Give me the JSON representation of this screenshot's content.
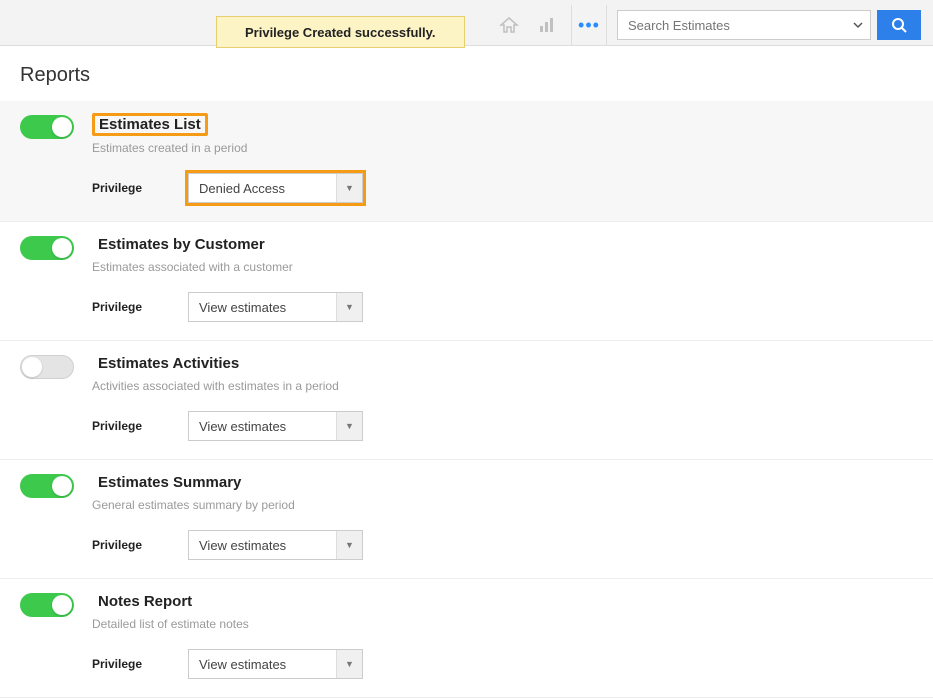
{
  "topbar": {
    "toast": "Privilege Created successfully.",
    "more_icon": "•••",
    "search_placeholder": "Search Estimates"
  },
  "page": {
    "title": "Reports",
    "privilege_label": "Privilege"
  },
  "reports": [
    {
      "title": "Estimates List",
      "desc": "Estimates created in a period",
      "enabled": true,
      "privilege": "Denied Access",
      "highlighted": true,
      "select_highlighted": true,
      "title_highlighted": true
    },
    {
      "title": "Estimates by Customer",
      "desc": "Estimates associated with a customer",
      "enabled": true,
      "privilege": "View estimates",
      "highlighted": false
    },
    {
      "title": "Estimates Activities",
      "desc": "Activities associated with estimates in a period",
      "enabled": false,
      "privilege": "View estimates",
      "highlighted": false
    },
    {
      "title": "Estimates Summary",
      "desc": "General estimates summary by period",
      "enabled": true,
      "privilege": "View estimates",
      "highlighted": false
    },
    {
      "title": "Notes Report",
      "desc": "Detailed list of estimate notes",
      "enabled": true,
      "privilege": "View estimates",
      "highlighted": false
    }
  ]
}
